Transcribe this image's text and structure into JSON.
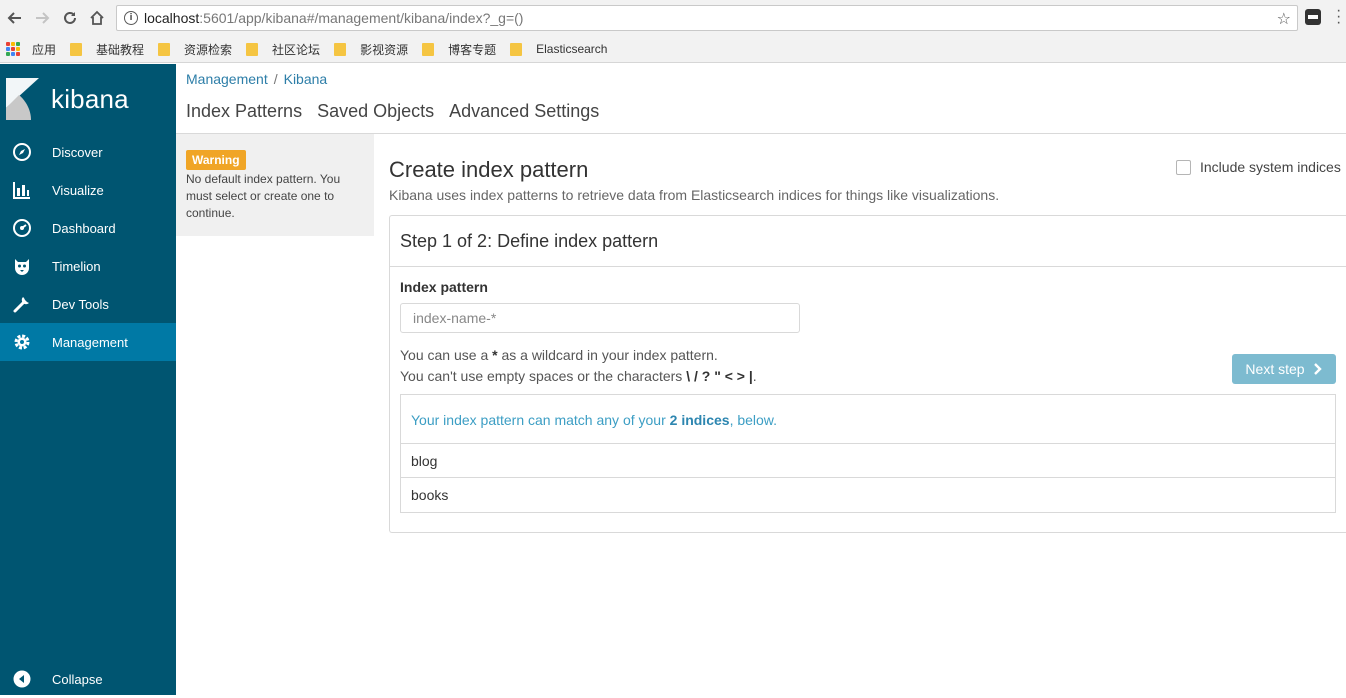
{
  "browser": {
    "url_host": "localhost",
    "url_rest": ":5601/app/kibana#/management/kibana/index?_g=()",
    "bookmarks": [
      {
        "label": "应用",
        "type": "apps"
      },
      {
        "label": "基础教程",
        "type": "folder"
      },
      {
        "label": "资源检索",
        "type": "folder"
      },
      {
        "label": "社区论坛",
        "type": "folder"
      },
      {
        "label": "影视资源",
        "type": "folder"
      },
      {
        "label": "博客专题",
        "type": "folder"
      },
      {
        "label": "Elasticsearch",
        "type": "folder"
      }
    ]
  },
  "sidebar": {
    "logo_text": "kibana",
    "items": [
      {
        "label": "Discover",
        "icon": "compass-icon"
      },
      {
        "label": "Visualize",
        "icon": "bar-chart-icon"
      },
      {
        "label": "Dashboard",
        "icon": "gauge-icon"
      },
      {
        "label": "Timelion",
        "icon": "timelion-icon"
      },
      {
        "label": "Dev Tools",
        "icon": "wrench-icon"
      },
      {
        "label": "Management",
        "icon": "gear-icon",
        "active": true
      }
    ],
    "collapse_label": "Collapse"
  },
  "breadcrumb": {
    "first": "Management",
    "separator": "/",
    "second": "Kibana"
  },
  "tabs": [
    "Index Patterns",
    "Saved Objects",
    "Advanced Settings"
  ],
  "warning": {
    "badge": "Warning",
    "text": "No default index pattern. You must select or create one to continue."
  },
  "page": {
    "title": "Create index pattern",
    "subtitle": "Kibana uses index patterns to retrieve data from Elasticsearch indices for things like visualizations.",
    "system_indices_label": "Include system indices"
  },
  "step": {
    "heading": "Step 1 of 2: Define index pattern",
    "field_label": "Index pattern",
    "placeholder": "index-name-*",
    "hint_1_pre": "You can use a ",
    "hint_1_mark": "*",
    "hint_1_post": " as a wildcard in your index pattern.",
    "hint_2_pre": "You can't use empty spaces or the characters ",
    "hint_2_chars": "\\ / ? \" < > |",
    "hint_2_post": ".",
    "next_label": "Next step",
    "match_pre": "Your index pattern can match any of your ",
    "match_count": "2 indices",
    "match_post": ", below.",
    "indices": [
      "blog",
      "books"
    ]
  }
}
